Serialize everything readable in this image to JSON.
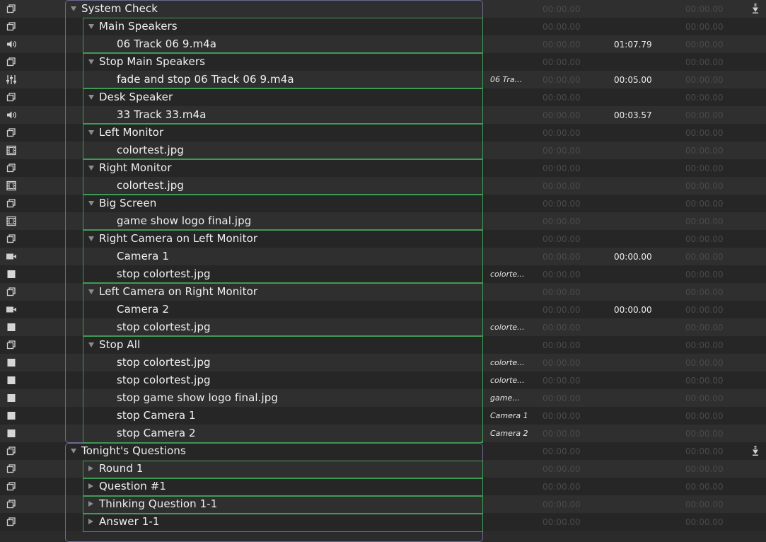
{
  "placeholder_time": "00:00.00",
  "rows": [
    {
      "icon": "group-icon",
      "depth": 0,
      "disclosure": "open",
      "name": "System Check",
      "target": "",
      "action": "",
      "continue": true
    },
    {
      "icon": "group-icon",
      "depth": 1,
      "disclosure": "open",
      "name": "Main Speakers",
      "target": "",
      "action": ""
    },
    {
      "icon": "speaker-icon",
      "depth": 2,
      "disclosure": "",
      "name": "06 Track 06 9.m4a",
      "target": "",
      "action": "01:07.79"
    },
    {
      "icon": "group-icon",
      "depth": 1,
      "disclosure": "open",
      "name": "Stop Main Speakers",
      "target": "",
      "action": ""
    },
    {
      "icon": "fade-icon",
      "depth": 2,
      "disclosure": "",
      "name": "fade and stop 06 Track 06 9.m4a",
      "target": "06 Tra...",
      "action": "00:05.00"
    },
    {
      "icon": "group-icon",
      "depth": 1,
      "disclosure": "open",
      "name": "Desk Speaker",
      "target": "",
      "action": ""
    },
    {
      "icon": "speaker-icon",
      "depth": 2,
      "disclosure": "",
      "name": "33 Track 33.m4a",
      "target": "",
      "action": "00:03.57"
    },
    {
      "icon": "group-icon",
      "depth": 1,
      "disclosure": "open",
      "name": "Left Monitor",
      "target": "",
      "action": ""
    },
    {
      "icon": "film-icon",
      "depth": 2,
      "disclosure": "",
      "name": "colortest.jpg",
      "target": "",
      "action": ""
    },
    {
      "icon": "group-icon",
      "depth": 1,
      "disclosure": "open",
      "name": "Right Monitor",
      "target": "",
      "action": ""
    },
    {
      "icon": "film-icon",
      "depth": 2,
      "disclosure": "",
      "name": "colortest.jpg",
      "target": "",
      "action": ""
    },
    {
      "icon": "group-icon",
      "depth": 1,
      "disclosure": "open",
      "name": "Big Screen",
      "target": "",
      "action": ""
    },
    {
      "icon": "film-icon",
      "depth": 2,
      "disclosure": "",
      "name": "game show logo final.jpg",
      "target": "",
      "action": ""
    },
    {
      "icon": "group-icon",
      "depth": 1,
      "disclosure": "open",
      "name": "Right Camera on Left Monitor",
      "target": "",
      "action": ""
    },
    {
      "icon": "camera-icon",
      "depth": 2,
      "disclosure": "",
      "name": "Camera 1",
      "target": "",
      "action": "00:00.00"
    },
    {
      "icon": "stop-icon",
      "depth": 2,
      "disclosure": "",
      "name": "stop colortest.jpg",
      "target": "colorte...",
      "action": ""
    },
    {
      "icon": "group-icon",
      "depth": 1,
      "disclosure": "open",
      "name": "Left Camera on Right Monitor",
      "target": "",
      "action": ""
    },
    {
      "icon": "camera-icon",
      "depth": 2,
      "disclosure": "",
      "name": "Camera 2",
      "target": "",
      "action": "00:00.00"
    },
    {
      "icon": "stop-icon",
      "depth": 2,
      "disclosure": "",
      "name": "stop colortest.jpg",
      "target": "colorte...",
      "action": ""
    },
    {
      "icon": "group-icon",
      "depth": 1,
      "disclosure": "open",
      "name": "Stop All",
      "target": "",
      "action": ""
    },
    {
      "icon": "stop-icon",
      "depth": 2,
      "disclosure": "",
      "name": "stop colortest.jpg",
      "target": "colorte...",
      "action": ""
    },
    {
      "icon": "stop-icon",
      "depth": 2,
      "disclosure": "",
      "name": "stop colortest.jpg",
      "target": "colorte...",
      "action": ""
    },
    {
      "icon": "stop-icon",
      "depth": 2,
      "disclosure": "",
      "name": "stop game show logo final.jpg",
      "target": "game...",
      "action": ""
    },
    {
      "icon": "stop-icon",
      "depth": 2,
      "disclosure": "",
      "name": "stop Camera 1",
      "target": "Camera 1",
      "action": ""
    },
    {
      "icon": "stop-icon",
      "depth": 2,
      "disclosure": "",
      "name": "stop Camera 2",
      "target": "Camera 2",
      "action": ""
    },
    {
      "icon": "group-icon",
      "depth": 0,
      "disclosure": "open",
      "name": "Tonight's Questions",
      "target": "",
      "action": "",
      "continue": true
    },
    {
      "icon": "group-icon",
      "depth": 1,
      "disclosure": "closed",
      "name": "Round 1",
      "target": "",
      "action": ""
    },
    {
      "icon": "group-icon",
      "depth": 1,
      "disclosure": "closed",
      "name": "Question #1",
      "target": "",
      "action": ""
    },
    {
      "icon": "group-icon",
      "depth": 1,
      "disclosure": "closed",
      "name": "Thinking Question 1-1",
      "target": "",
      "action": ""
    },
    {
      "icon": "group-icon",
      "depth": 1,
      "disclosure": "closed",
      "name": "Answer 1-1",
      "target": "",
      "action": ""
    }
  ]
}
